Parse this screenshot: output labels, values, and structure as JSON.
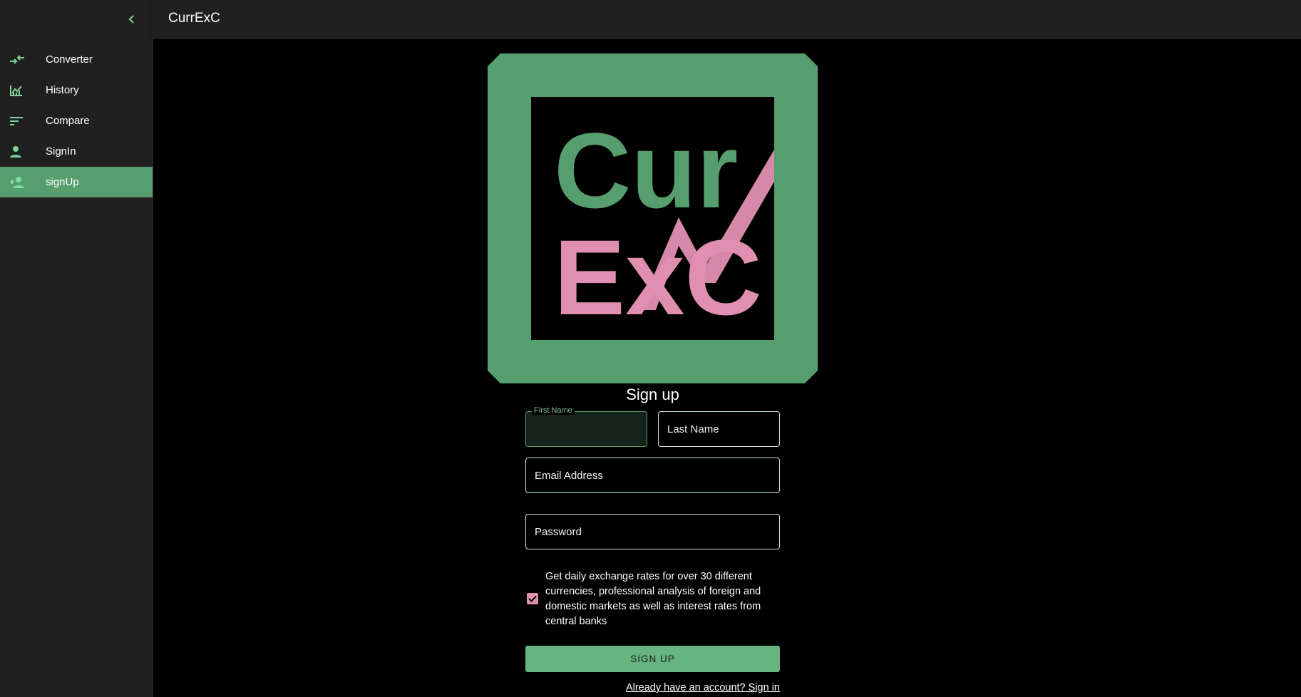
{
  "app": {
    "title": "CurrExC"
  },
  "sidebar": {
    "collapse_icon": "chevron-left-icon",
    "items": [
      {
        "label": "Converter",
        "icon": "compare-arrows-icon",
        "active": false
      },
      {
        "label": "History",
        "icon": "chart-icon",
        "active": false
      },
      {
        "label": "Compare",
        "icon": "sort-lines-icon",
        "active": false
      },
      {
        "label": "SignIn",
        "icon": "person-icon",
        "active": false
      },
      {
        "label": "signUp",
        "icon": "person-add-icon",
        "active": true
      }
    ]
  },
  "logo": {
    "line1": "Cur",
    "line2": "ExC"
  },
  "form": {
    "title": "Sign up",
    "first_name": {
      "label": "First Name",
      "value": ""
    },
    "last_name": {
      "placeholder": "Last Name",
      "value": ""
    },
    "email": {
      "placeholder": "Email Address",
      "value": ""
    },
    "password": {
      "placeholder": "Password",
      "value": ""
    },
    "consent": {
      "checked": true,
      "text": "Get daily exchange rates for over 30 different currencies, professional analysis of foreign and domestic markets as well as interest rates from central banks"
    },
    "submit_label": "SIGN UP",
    "signin_link": "Already have an account? Sign in"
  },
  "colors": {
    "accent_green": "#569e6e",
    "button_green": "#66b581",
    "accent_pink": "#e08fb0",
    "sidebar_bg": "#202020",
    "page_bg": "#000000"
  }
}
